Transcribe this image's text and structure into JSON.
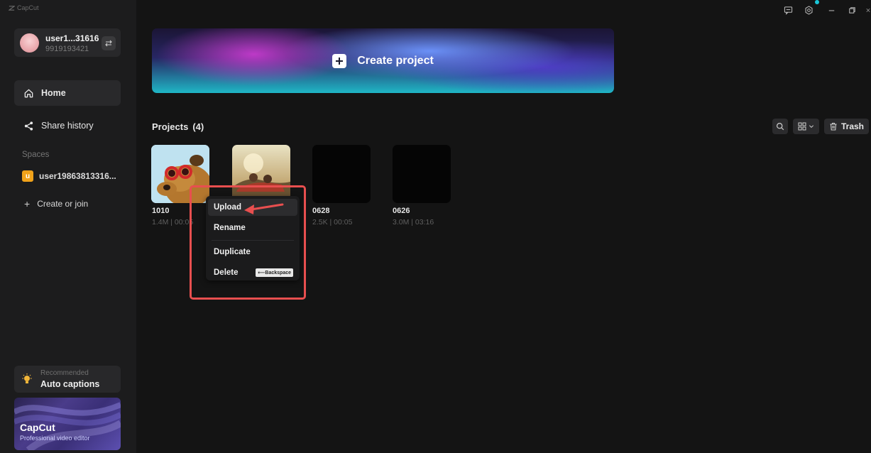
{
  "app": {
    "brand": "CapCut"
  },
  "user": {
    "name": "user1...31616",
    "id": "9919193421"
  },
  "nav": [
    {
      "label": "Home",
      "icon": "home-icon",
      "active": true
    },
    {
      "label": "Share history",
      "icon": "share-icon",
      "active": false
    }
  ],
  "spaces": {
    "title": "Spaces",
    "item": {
      "badge": "u",
      "label": "user19863813316..."
    },
    "create_join": "Create or join"
  },
  "recommended": {
    "small": "Recommended",
    "title": "Auto captions"
  },
  "promo": {
    "title": "CapCut",
    "subtitle": "Professional video editor"
  },
  "banner": {
    "label": "Create project"
  },
  "projects": {
    "title": "Projects",
    "count": "(4)",
    "trash_label": "Trash",
    "items": [
      {
        "title": "1010",
        "meta": "1.4M | 00:05"
      },
      {
        "title": "",
        "meta": ""
      },
      {
        "title": "0628",
        "meta": "2.5K | 00:05"
      },
      {
        "title": "0626",
        "meta": "3.0M | 03:16"
      }
    ]
  },
  "context_menu": {
    "items": [
      "Upload",
      "Rename",
      "Duplicate",
      "Delete"
    ],
    "delete_shortcut": "⟵Backspace"
  },
  "colors": {
    "highlight": "#e84f4f",
    "accent_dot": "#19c7d8",
    "space_badge": "#f0a21a"
  }
}
